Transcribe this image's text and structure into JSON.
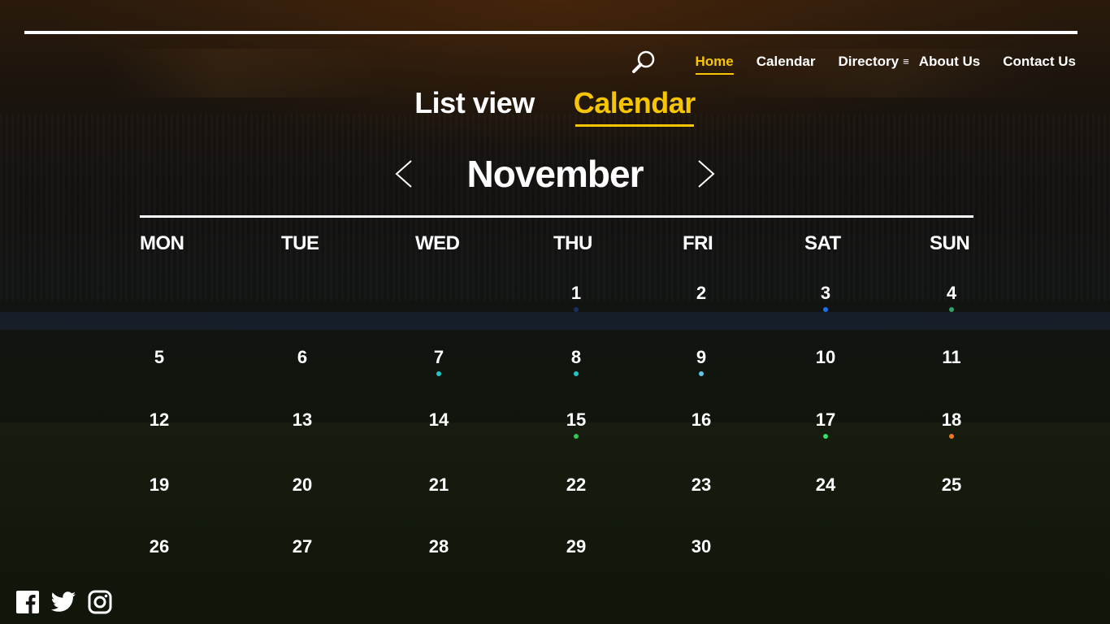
{
  "nav": {
    "search_icon": "magnifier-icon",
    "items": [
      {
        "label": "Home",
        "active": true
      },
      {
        "label": "Calendar",
        "active": false
      },
      {
        "label": "Directory",
        "active": false,
        "menu_glyph": "≡"
      },
      {
        "label": "About Us",
        "active": false
      },
      {
        "label": "Contact Us",
        "active": false
      }
    ]
  },
  "view_tabs": [
    {
      "label": "List view",
      "active": false
    },
    {
      "label": "Calendar",
      "active": true
    }
  ],
  "calendar": {
    "month": "November",
    "prev_icon": "chevron-left-icon",
    "next_icon": "chevron-right-icon",
    "weekdays": [
      "MON",
      "TUE",
      "WED",
      "THU",
      "FRI",
      "SAT",
      "SUN"
    ],
    "weeks": [
      [
        null,
        null,
        null,
        {
          "d": "1",
          "dot": "#1b2f5e"
        },
        {
          "d": "2"
        },
        {
          "d": "3",
          "dot": "#1e6ff0"
        },
        {
          "d": "4",
          "dot": "#2ea46a"
        }
      ],
      [
        {
          "d": "5"
        },
        {
          "d": "6"
        },
        {
          "d": "7",
          "dot": "#22c6c6"
        },
        {
          "d": "8",
          "dot": "#22c6c6"
        },
        {
          "d": "9",
          "dot": "#5cc8ef"
        },
        {
          "d": "10"
        },
        {
          "d": "11"
        }
      ],
      [
        {
          "d": "12"
        },
        {
          "d": "13"
        },
        {
          "d": "14"
        },
        {
          "d": "15",
          "dot": "#2ec65a"
        },
        {
          "d": "16"
        },
        {
          "d": "17",
          "dot": "#35e06a"
        },
        {
          "d": "18",
          "dot": "#f07a22"
        }
      ],
      [
        {
          "d": "19"
        },
        {
          "d": "20"
        },
        {
          "d": "21"
        },
        {
          "d": "22"
        },
        {
          "d": "23"
        },
        {
          "d": "24"
        },
        {
          "d": "25"
        }
      ],
      [
        {
          "d": "26"
        },
        {
          "d": "27"
        },
        {
          "d": "28"
        },
        {
          "d": "29"
        },
        {
          "d": "30"
        },
        null,
        null
      ]
    ]
  },
  "social": [
    "facebook-icon",
    "twitter-icon",
    "instagram-icon"
  ],
  "colors": {
    "accent": "#f7c600",
    "text": "#ffffff"
  }
}
